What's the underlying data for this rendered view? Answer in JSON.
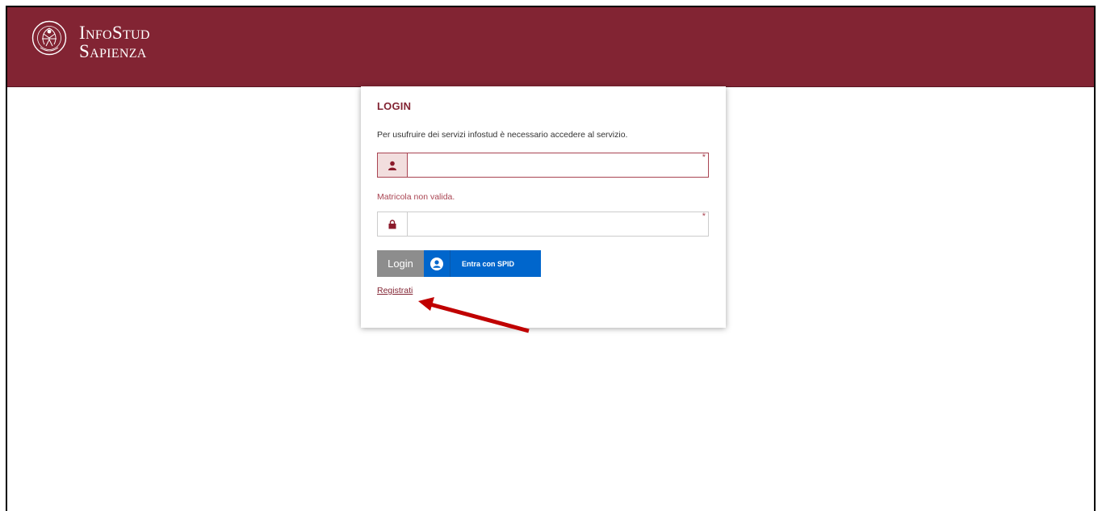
{
  "header": {
    "brand_line1": "InfoStud",
    "brand_line2": "Sapienza",
    "color": "#822433"
  },
  "login": {
    "title": "LOGIN",
    "intro": "Per usufruire dei servizi infostud è necessario accedere al servizio.",
    "username": {
      "value": "",
      "required_mark": "*",
      "icon": "user-icon"
    },
    "error": "Matricola non valida.",
    "password": {
      "value": "",
      "required_mark": "*",
      "icon": "lock-icon"
    },
    "login_button": "Login",
    "spid_button": "Entra con SPID",
    "register_link": "Registrati"
  },
  "annotation": {
    "color": "#c00000",
    "target": "register-link"
  }
}
